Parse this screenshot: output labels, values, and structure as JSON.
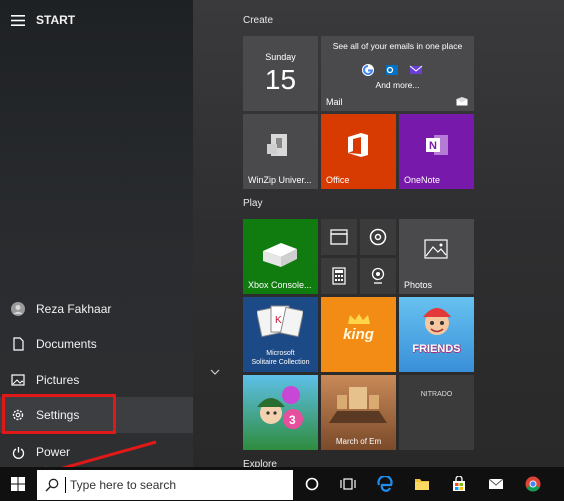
{
  "start_menu": {
    "title": "START",
    "user": "Reza Fakhaar",
    "items": [
      "Documents",
      "Pictures",
      "Settings",
      "Power"
    ]
  },
  "groups": {
    "create": "Create",
    "play": "Play",
    "explore": "Explore"
  },
  "tiles": {
    "calendar_day": "Sunday",
    "calendar_date": "15",
    "mail_heading": "See all of your emails in one place",
    "mail_more": "And more...",
    "mail_label": "Mail",
    "winzip_label": "WinZip Univer...",
    "office_label": "Office",
    "onenote_label": "OneNote",
    "xbox_label": "Xbox Console...",
    "photos_label": "Photos",
    "solitaire_line1": "Microsoft",
    "solitaire_line2": "Solitaire Collection",
    "king_label": "king",
    "friends_label": "FRIENDS",
    "march_label": "March of Em",
    "nitrado_label": "NITRADO"
  },
  "taskbar": {
    "search_placeholder": "Type here to search"
  },
  "colors": {
    "highlight": "#e01818",
    "office": "#d83b01",
    "onenote": "#7719aa",
    "xbox": "#107c10",
    "accent": "#0078d7"
  }
}
